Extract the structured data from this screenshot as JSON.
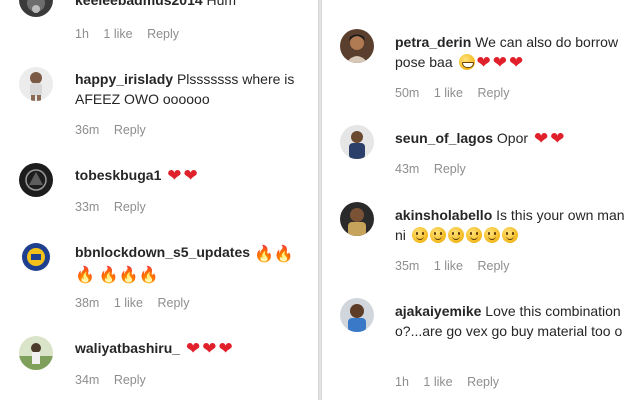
{
  "left_column": {
    "comments": [
      {
        "username": "keeleebadmus2014",
        "text": "Hum",
        "time": "1h",
        "likes": "1 like",
        "reply": "Reply",
        "emojis": []
      },
      {
        "username": "happy_irislady",
        "text": "Plsssssss where is AFEEZ OWO oooooo",
        "time": "36m",
        "reply": "Reply",
        "emojis": []
      },
      {
        "username": "tobeskbuga1",
        "text": "",
        "time": "33m",
        "reply": "Reply",
        "emojis": [
          "heart",
          "heart"
        ]
      },
      {
        "username": "bbnlockdown_s5_updates",
        "text": "",
        "time": "38m",
        "likes": "1 like",
        "reply": "Reply",
        "emojis": [
          "fire",
          "fire",
          "fire",
          "fire",
          "fire",
          "fire"
        ]
      },
      {
        "username": "waliyatbashiru_",
        "text": "",
        "time": "34m",
        "reply": "Reply",
        "emojis": [
          "heart",
          "heart",
          "heart"
        ]
      }
    ]
  },
  "right_column": {
    "comments": [
      {
        "username": "petra_derin",
        "text": "We can also do borrow pose baa",
        "time": "50m",
        "likes": "1 like",
        "reply": "Reply",
        "emojis": [
          "grin",
          "heart",
          "heart",
          "heart"
        ]
      },
      {
        "username": "seun_of_lagos",
        "text": "Opor",
        "time": "43m",
        "reply": "Reply",
        "emojis": [
          "heart",
          "heart"
        ]
      },
      {
        "username": "akinsholabello",
        "text": "Is this your own man ni",
        "time": "35m",
        "likes": "1 like",
        "reply": "Reply",
        "emojis": [
          "smile",
          "smile",
          "smile",
          "smile",
          "smile",
          "smile"
        ]
      },
      {
        "username": "ajakaiyemike",
        "text": "Love this combination o?...are go vex go buy material too o",
        "time": "1h",
        "likes": "1 like",
        "reply": "Reply",
        "emojis": []
      }
    ]
  },
  "colors": {
    "heart": "#e0202b",
    "meta_text": "#8e8e8e",
    "username_text": "#262626",
    "divider": "#d6d6d6"
  },
  "icons": {
    "heart": "red-heart-emoji",
    "fire": "fire-emoji",
    "smile": "smiling-face-emoji",
    "grin": "grimacing-face-emoji"
  }
}
